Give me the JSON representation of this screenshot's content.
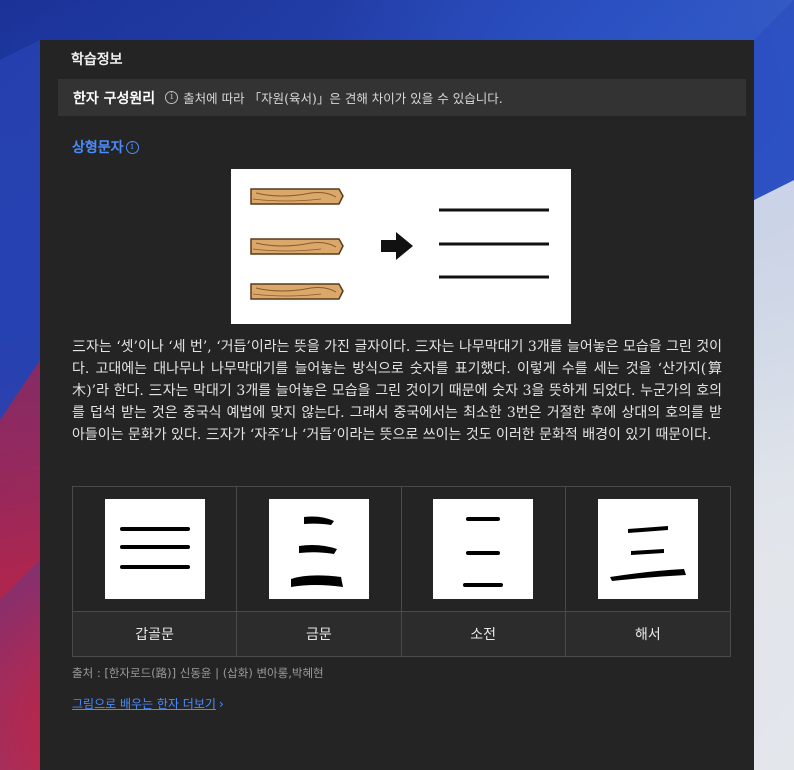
{
  "panel": {
    "title": "학습정보",
    "principle": {
      "label": "한자 구성원리",
      "note": "출처에 따라 「자원(육서)」은 견해 차이가 있을 수 있습니다."
    },
    "char_type": "상형문자",
    "description": "三자는 ‘셋’이나 ‘세 번’, ‘거듭’이라는 뜻을 가진 글자이다. 三자는 나무막대기 3개를 늘어놓은 모습을 그린 것이다. 고대에는 대나무나 나무막대기를 늘어놓는 방식으로 숫자를 표기했다. 이렇게 수를 세는 것을 ‘산가지(算木)’라 한다. 三자는 막대기 3개를 늘어놓은 모습을 그린 것이기 때문에 숫자 3을 뜻하게 되었다. 누군가의 호의를 덥석 받는 것은 중국식 예법에 맞지 않는다. 그래서 중국에서는 최소한 3번은 거절한 후에 상대의 호의를 받아들이는 문화가 있다. 三자가 ‘자주’나 ‘거듭’이라는 뜻으로 쓰이는 것도 이러한 문화적 배경이 있기 때문이다.",
    "scripts": [
      {
        "name": "갑골문"
      },
      {
        "name": "금문"
      },
      {
        "name": "소전"
      },
      {
        "name": "해서"
      }
    ],
    "source": "출처 : [한자로드(路)] 신동윤 | (삽화) 변아롱,박혜현",
    "more_link": "그림으로 배우는 한자 더보기",
    "icons": {
      "info": "info-icon",
      "chevron": "chevron-right-icon",
      "arrow": "arrow-right-icon"
    },
    "colors": {
      "panel_bg": "#242424",
      "accent": "#4a8cff"
    }
  }
}
